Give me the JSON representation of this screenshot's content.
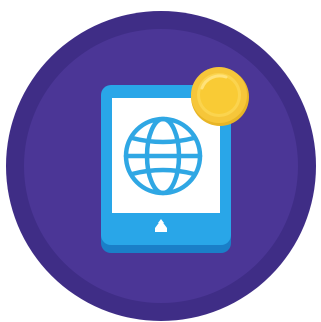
{
  "icon": {
    "name": "tablet-browser-coin-badge",
    "parts": [
      "circle-badge",
      "tablet",
      "globe",
      "home-button",
      "coin"
    ]
  },
  "colors": {
    "badge_outer": "#3f2d86",
    "badge_inner": "#4b3696",
    "tablet_shadow": "#1a7fc8",
    "tablet_body": "#29a6e8",
    "tablet_screen": "#ffffff",
    "globe_stroke": "#2fa7e4",
    "home_button": "#ffffff",
    "coin_outer": "#f6c63a",
    "coin_ring": "#fbd44e",
    "coin_inner": "#f9cb35",
    "coin_highlight": "#ffe27a"
  }
}
